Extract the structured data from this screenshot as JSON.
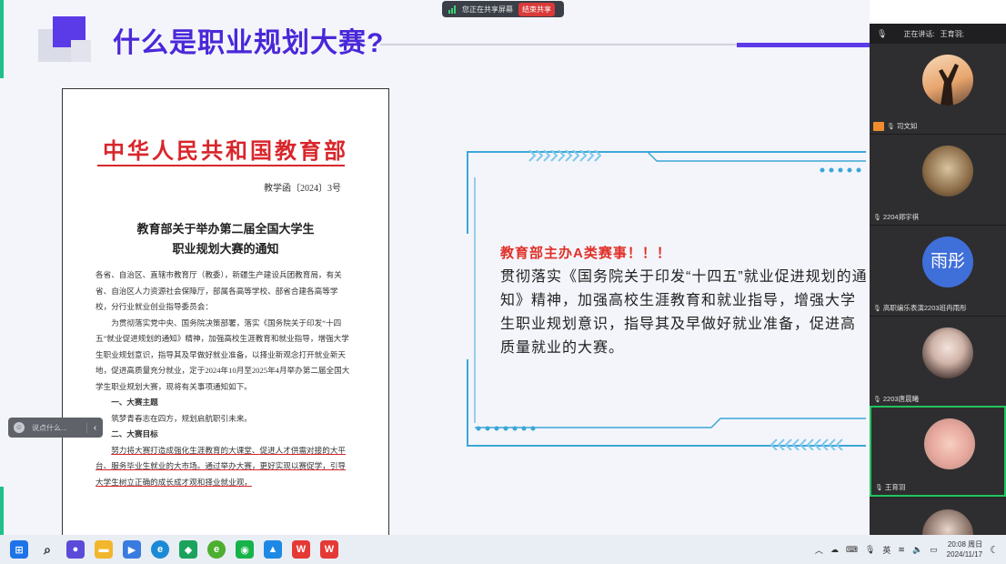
{
  "share_bar": {
    "status": "您正在共享屏幕",
    "stop_label": "结束共享"
  },
  "slide": {
    "title": "什么是职业规划大赛?",
    "document": {
      "header": "中华人民共和国教育部",
      "doc_number": "教学函〔2024〕3号",
      "title_line1": "教育部关于举办第二届全国大学生",
      "title_line2": "职业规划大赛的通知",
      "paragraphs": [
        "各省、自治区、直辖市教育厅（教委），新疆生产建设兵团教育局，有关省、自治区人力资源社会保障厅，部属各高等学校、部省合建各高等学校，分行业就业创业指导委员会：",
        "为贯彻落实党中央、国务院决策部署，落实《国务院关于印发“十四五”就业促进规划的通知》精神，加强高校生涯教育和就业指导，增强大学生职业规划意识，指导其及早做好就业准备，以择业新观念打开就业新天地，促进高质量充分就业，定于2024年10月至2025年4月举办第二届全国大学生职业规划大赛，现将有关事项通知如下。",
        "一、大赛主题",
        "筑梦青春志在四方，规划启航职引未来。",
        "二、大赛目标",
        "努力将大赛打造成强化生涯教育的大课堂、促进人才供需对接的大平台、服务毕业生就业的大市场。通过举办大赛，更好实现以赛促学，引导大学生树立正确的成长成才观和择业就业观，"
      ]
    },
    "callout": {
      "heading": "教育部主办A类赛事！！！",
      "body": "贯彻落实《国务院关于印发“十四五”就业促进规划的通知》精神，加强高校生涯教育和就业指导，增强大学生职业规划意识，指导其及早做好就业准备，促进高质量就业的大赛。"
    },
    "comment_pill": {
      "placeholder": "说点什么..."
    }
  },
  "panel": {
    "speaking_label": "正在讲话:",
    "speaking_name": "王育羽;",
    "participants": [
      {
        "name": "司文如",
        "avatar": "photo-silhouette",
        "raised_hand": true
      },
      {
        "name": "2204郑宇祺",
        "avatar": "photo-dragon"
      },
      {
        "name": "高职编乐表演2203班冉雨彤",
        "avatar": "text",
        "avatar_text": "雨彤"
      },
      {
        "name": "2203唐晨曦",
        "avatar": "photo-girl"
      },
      {
        "name": "王育羽",
        "avatar": "photo-cartoon",
        "active": true
      },
      {
        "name": "",
        "avatar": "photo-girl2"
      }
    ]
  },
  "taskbar": {
    "tray_lang": "英",
    "time": "20:08 周日",
    "date": "2024/11/17"
  },
  "colors": {
    "title_purple": "#4a28d8",
    "red": "#d8262b",
    "frame_blue": "#3ba7d8",
    "active_green": "#22c55e"
  }
}
